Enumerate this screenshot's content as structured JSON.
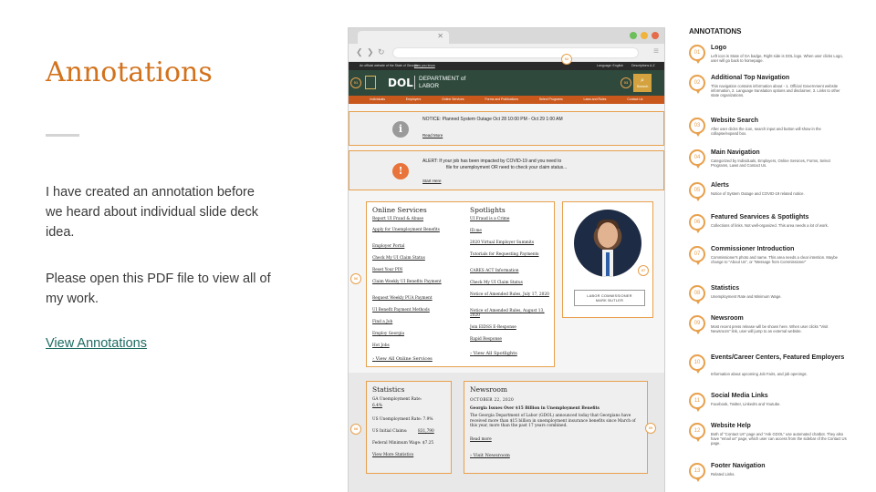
{
  "slide": {
    "title": "Annotations",
    "paragraph1": "I have created an annotation before we heard about individual slide deck idea.",
    "paragraph2": "Please open this PDF file to view all of my work.",
    "link": "View Annotations"
  },
  "browser": {
    "window_dots": [
      "#6cbf5a",
      "#f0b43c",
      "#e46c4b"
    ],
    "topbar": {
      "official": "An official website of the State of Georgia",
      "how": "How you know",
      "language": "Language: English",
      "translate": "Descriptions A-Z"
    },
    "header": {
      "dol": "DOL",
      "dept_line1": "DEPARTMENT of",
      "dept_line2": "LABOR",
      "search": "Search"
    },
    "main_nav": [
      "Individuals",
      "Employers",
      "Online Services",
      "Forms and Publications",
      "Select Programs",
      "Laws and Rules",
      "Contact Us"
    ],
    "notice": {
      "text": "NOTICE:  Planned System Outage Oct 28 10:00 PM - Oct 29 1:00 AM",
      "link": "Read More",
      "icon": "i"
    },
    "alert": {
      "line1": "ALERT:  If your job has been impacted by COVID-19 and you need to",
      "line2": "file for unemployment OR need to check your claim status...",
      "link": "Start Here",
      "icon": "!"
    },
    "online_services": {
      "heading": "Online Services",
      "links": [
        "Report UI Fraud & Abuse",
        "Apply for Unemployment Benefits",
        "Employer Portal",
        "Check My UI Claim Status",
        "Reset Your PIN",
        "Claim Weekly UI Benefits Payment",
        "Request Weekly PUA Payment",
        "UI Benefit Payment Methods",
        "Find a Job",
        "Employ Georgia",
        "Hot Jobs"
      ],
      "view_all": "View All Online Services"
    },
    "spotlights": {
      "heading": "Spotlights",
      "links": [
        "UI Fraud is a Crime",
        "ID.me",
        "2020 Virtual Employer Summits",
        "Tutorials for Requesting Payments",
        "CARES ACT Information",
        "Check My UI Claim Status",
        "Notice of Amended Rules, July 17, 2020",
        "Notice of Amended Rules, August 13, 2020",
        "Join EIDSS E-Response",
        "Rapid Response"
      ],
      "view_all": "View All Spotlights"
    },
    "commissioner": {
      "line1": "LABOR COMMISSIONER",
      "line2": "MARK BUTLER"
    },
    "statistics": {
      "heading": "Statistics",
      "rows": [
        "GA Unemployment Rate:",
        "6.4%",
        "US Unemployment Rate: 7.9%",
        "US Initial Claims:",
        "831,790",
        "Federal Minimum Wage: $7.25"
      ],
      "link": "View More Statistics"
    },
    "newsroom": {
      "heading": "Newsroom",
      "date": "OCTOBER 22, 2020",
      "headline": "Georgia Issues Over $15 Billion in Unemployment Benefits",
      "body": "The Georgia Department of Labor (GDOL) announced today that Georgians have received more than $15 billion in unemployment insurance benefits since March of this year, more than the past 17 years combined.",
      "read_more": "Read more",
      "visit": "Visit Newsroom"
    },
    "markers": [
      "01",
      "02",
      "03",
      "04",
      "05",
      "06",
      "07",
      "08",
      "09"
    ]
  },
  "annotations": {
    "title": "ANNOTATIONS",
    "items": [
      {
        "num": "01",
        "title": "Logo",
        "desc": "Left icon is State of GA badge, Right side is DOL logo. When user clicks Logo, user will go back to homepage."
      },
      {
        "num": "02",
        "title": "Additional Top Navigation",
        "desc": "This navigation contains information about - 1. Official Government website information, 2. Language translation options and disclaimer, 3. Links to other state organizations."
      },
      {
        "num": "03",
        "title": "Website Search",
        "desc": "After user clicks the icon, search input and button will show in the collapse/expand box."
      },
      {
        "num": "04",
        "title": "Main Navigation",
        "desc": "Categorized by Individuals, Employers, Online Services, Forms, Select Programs, Laws and Contact Us."
      },
      {
        "num": "05",
        "title": "Alerts",
        "desc": "Notice of System Outage and  COVID-19 related notice."
      },
      {
        "num": "06",
        "title": "Featured Searvices & Spotlights",
        "desc": "Collections of links. Not well-organized. This area needs a lot of work."
      },
      {
        "num": "07",
        "title": "Commissioner Introduction",
        "desc": "Commissioner's photo and name. This area needs a clear intention. Maybe change to \"About Us\", or \"Message from Commissioner\""
      },
      {
        "num": "08",
        "title": "Statistics",
        "desc": "Unemployment Rate and Minimum Wage."
      },
      {
        "num": "09",
        "title": "Newsroom",
        "desc": "Most recent press release will be shown here. When user clicks \"Visit Newsroom\" link, user will jump to an external website."
      },
      {
        "num": "10",
        "title": "Events/Career Centers, Featured Employers",
        "desc": "Information about upcoming Job Fairs, and job openings."
      },
      {
        "num": "11",
        "title": "Social Media Links",
        "desc": "Facebook, Twitter, LinkedIn and Youtube."
      },
      {
        "num": "12",
        "title": "Website Help",
        "desc": "Both of \"Contact Us\" page and \"Ask GDOL\" use automated chatbot. They also have \"email us\" page, which user can access from the sidebar of the Contact Us page."
      },
      {
        "num": "13",
        "title": "Footer Navigation",
        "desc": "Related Links."
      }
    ]
  }
}
